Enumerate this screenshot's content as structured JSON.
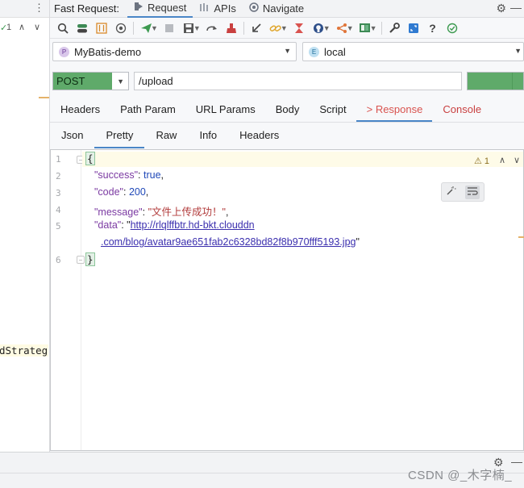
{
  "left_panel": {
    "kebab": "⋮",
    "check": "✓",
    "count": "1",
    "code_fragment": "dStrateg"
  },
  "titlebar": {
    "title": "Fast Request:",
    "tabs": [
      {
        "label": "Request",
        "icon": "request-icon"
      },
      {
        "label": "APIs",
        "icon": "apis-icon"
      },
      {
        "label": "Navigate",
        "icon": "navigate-icon"
      }
    ]
  },
  "project": {
    "badge": "P",
    "value": "MyBatis-demo"
  },
  "environment": {
    "badge": "E",
    "value": "local"
  },
  "request": {
    "method": "POST",
    "url": "/upload",
    "send_label": ""
  },
  "main_tabs": [
    "Headers",
    "Path Param",
    "URL Params",
    "Body",
    "Script",
    "> Response",
    "Console"
  ],
  "response_tabs": [
    "Json",
    "Pretty",
    "Raw",
    "Info",
    "Headers"
  ],
  "editor": {
    "line_numbers": [
      "1",
      "2",
      "3",
      "4",
      "5",
      "6"
    ],
    "warning_count": "1",
    "open_brace": "{",
    "close_brace": "}",
    "success_key": "\"success\"",
    "success_val": "true",
    "code_key": "\"code\"",
    "code_val": "200",
    "message_key": "\"message\"",
    "message_val": "\"文件上传成功！\"",
    "data_key": "\"data\"",
    "data_val_part1": "http://rlqlffbtr.hd-bkt.clouddn",
    "data_val_part2": ".com/blog/avatar9ae651fab2c6328bd82f8b970fff5193.jpg"
  },
  "watermark": "CSDN @_木字楠_",
  "colors": {
    "method_green": "#5faa6a",
    "active_tab_underline": "#4a86c7",
    "response_tab_color": "#d9534f"
  }
}
